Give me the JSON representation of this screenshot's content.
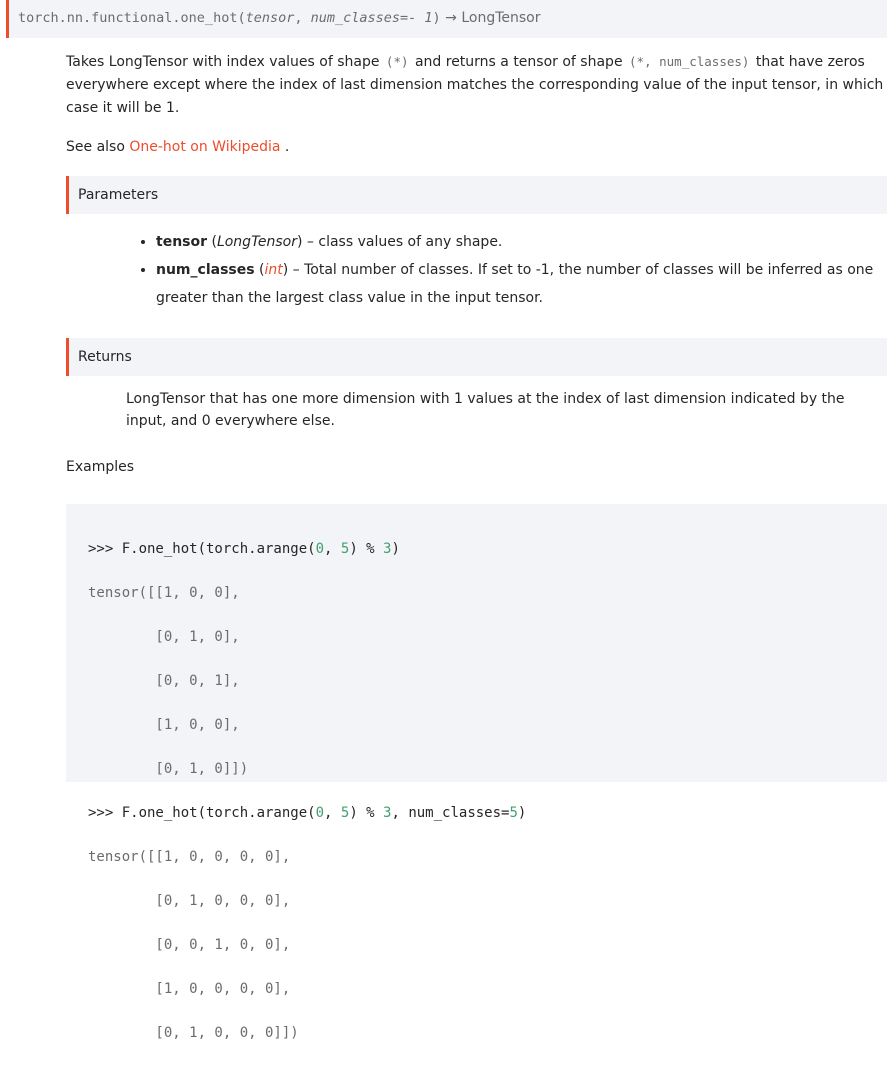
{
  "signature": {
    "name": "torch.nn.functional.one_hot(",
    "param1": "tensor",
    "sep": ", ",
    "param2": "num_classes=- 1",
    "close": ")",
    "arrow": " → ",
    "return_type": "LongTensor"
  },
  "description": {
    "part1": "Takes LongTensor with index values of shape ",
    "shape1": "(*)",
    "part2": " and returns a tensor of shape ",
    "shape2": "(*, num_classes)",
    "part3": " that have zeros everywhere except where the index of last dimension matches the corresponding value of the input tensor, in which case it will be 1."
  },
  "see_also": {
    "prefix": "See also ",
    "link": "One-hot on Wikipedia",
    "suffix": " ."
  },
  "parameters": {
    "heading": "Parameters",
    "items": [
      {
        "name": "tensor",
        "type_open": " (",
        "type": "LongTensor",
        "type_close": ")",
        "desc": " – class values of any shape."
      },
      {
        "name": "num_classes",
        "type_open": " (",
        "type": "int",
        "type_close": ")",
        "desc": " – Total number of classes. If set to -1, the number of classes will be inferred as one greater than the largest class value in the input tensor."
      }
    ]
  },
  "returns": {
    "heading": "Returns",
    "text": "LongTensor that has one more dimension with 1 values at the index of last dimension indicated by the input, and 0 everywhere else."
  },
  "examples": {
    "heading": "Examples",
    "lines": [
      ">>> F.one_hot(torch.arange(0, 5) % 3)",
      "tensor([[1, 0, 0],",
      "        [0, 1, 0],",
      "        [0, 0, 1],",
      "        [1, 0, 0],",
      "        [0, 1, 0]])",
      ">>> F.one_hot(torch.arange(0, 5) % 3, num_classes=5)",
      "tensor([[1, 0, 0, 0, 0],",
      "        [0, 1, 0, 0, 0],",
      "        [0, 0, 1, 0, 0],",
      "        [1, 0, 0, 0, 0],",
      "        [0, 1, 0, 0, 0]])"
    ]
  }
}
